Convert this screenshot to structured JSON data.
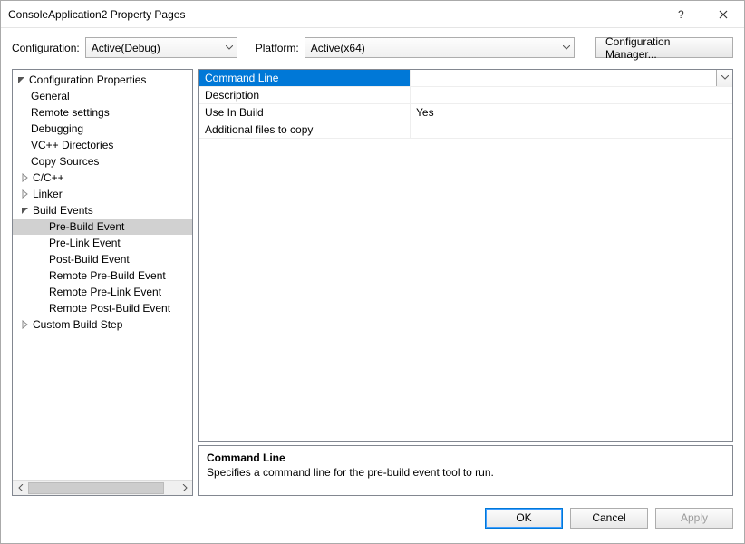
{
  "titlebar": {
    "title": "ConsoleApplication2 Property Pages"
  },
  "config": {
    "config_label": "Configuration:",
    "config_value": "Active(Debug)",
    "platform_label": "Platform:",
    "platform_value": "Active(x64)",
    "manager_label": "Configuration Manager..."
  },
  "tree": {
    "root": "Configuration Properties",
    "items": [
      {
        "label": "General"
      },
      {
        "label": "Remote settings"
      },
      {
        "label": "Debugging"
      },
      {
        "label": "VC++ Directories"
      },
      {
        "label": "Copy Sources"
      },
      {
        "label": "C/C++",
        "exp": "closed"
      },
      {
        "label": "Linker",
        "exp": "closed"
      },
      {
        "label": "Build Events",
        "exp": "open",
        "children": [
          {
            "label": "Pre-Build Event",
            "selected": true
          },
          {
            "label": "Pre-Link Event"
          },
          {
            "label": "Post-Build Event"
          },
          {
            "label": "Remote Pre-Build Event"
          },
          {
            "label": "Remote Pre-Link Event"
          },
          {
            "label": "Remote Post-Build Event"
          }
        ]
      },
      {
        "label": "Custom Build Step",
        "exp": "closed"
      }
    ]
  },
  "grid": {
    "rows": [
      {
        "name": "Command Line",
        "value": "",
        "selected": true
      },
      {
        "name": "Description",
        "value": ""
      },
      {
        "name": "Use In Build",
        "value": "Yes"
      },
      {
        "name": "Additional files to copy",
        "value": ""
      }
    ]
  },
  "description": {
    "title": "Command Line",
    "text": "Specifies a command line for the pre-build event tool to run."
  },
  "footer": {
    "ok": "OK",
    "cancel": "Cancel",
    "apply": "Apply"
  }
}
